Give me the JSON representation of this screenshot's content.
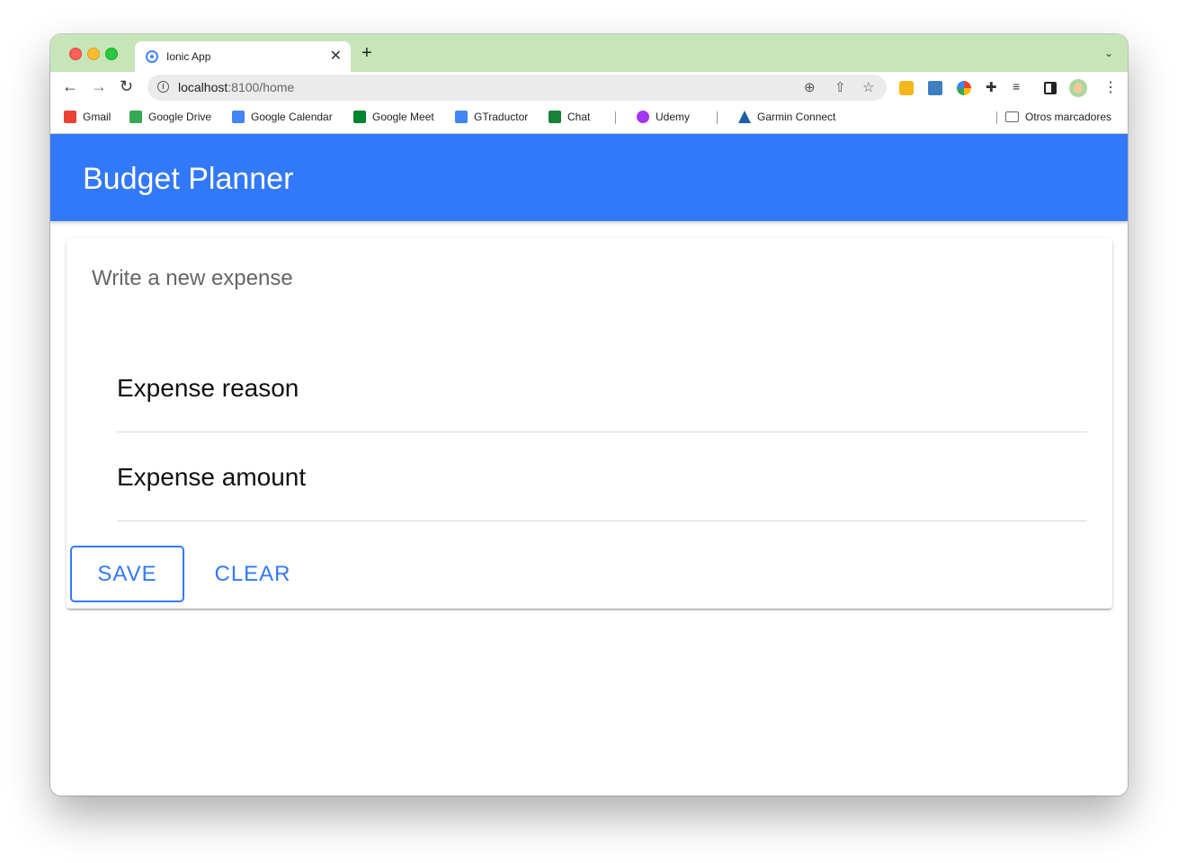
{
  "browser": {
    "tab_title": "Ionic App",
    "tab_close": "✕",
    "new_tab": "+",
    "tab_menu": "⌄",
    "url_host": "localhost",
    "url_rest": ":8100/home",
    "icons": [
      "back-arrow-icon",
      "forward-arrow-icon",
      "reload-icon",
      "info-icon",
      "zoom-icon",
      "share-icon",
      "star-icon",
      "extension-icons",
      "puzzle-icon",
      "media-icon",
      "side-panel-icon",
      "avatar-icon",
      "menu-icon"
    ]
  },
  "bookmarks": [
    {
      "label": "Gmail",
      "color": "#ea4335"
    },
    {
      "label": "Google Drive",
      "color": "#34a853"
    },
    {
      "label": "Google Calendar",
      "color": "#4285f4"
    },
    {
      "label": "Google Meet",
      "color": "#00832d"
    },
    {
      "label": "GTraductor",
      "color": "#4285f4"
    },
    {
      "label": "Chat",
      "color": "#188038"
    },
    {
      "label": "Udemy",
      "color": "#a435f0"
    },
    {
      "label": "Garmin Connect",
      "color": "#1a5fa8"
    },
    {
      "label": "Otros marcadores",
      "color": "#777777"
    }
  ],
  "app": {
    "title": "Budget Planner",
    "header_color": "#3279fa",
    "card": {
      "subtitle": "Write a new expense",
      "fields": [
        {
          "label": "Expense reason"
        },
        {
          "label": "Expense amount"
        }
      ],
      "buttons": {
        "save": "SAVE",
        "clear": "CLEAR"
      }
    }
  }
}
